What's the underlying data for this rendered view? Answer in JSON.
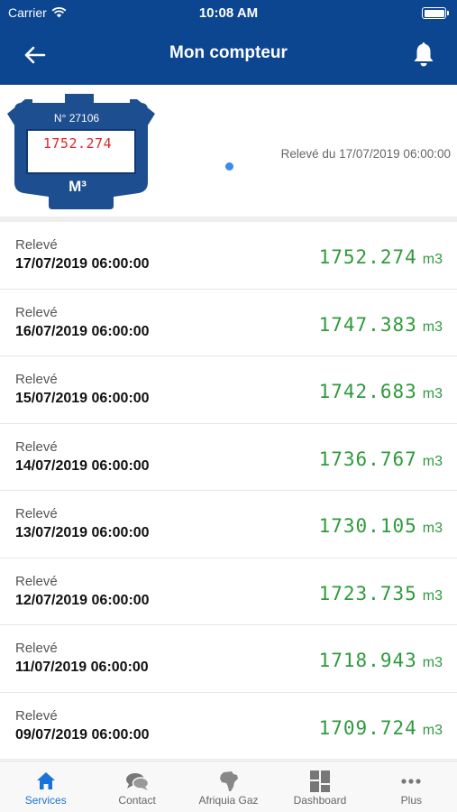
{
  "status_bar": {
    "carrier": "Carrier",
    "time": "10:08 AM"
  },
  "header": {
    "title": "Mon compteur",
    "back_icon": "arrow-left-icon",
    "bell_icon": "bell-icon"
  },
  "meter": {
    "number": "N° 27106",
    "reading": "1752.274",
    "unit": "M³",
    "releve_label": "Relevé du 17/07/2019 06:00:00"
  },
  "readings": [
    {
      "label": "Relevé",
      "date": "17/07/2019 06:00:00",
      "value": "1752.274",
      "unit": "m3"
    },
    {
      "label": "Relevé",
      "date": "16/07/2019 06:00:00",
      "value": "1747.383",
      "unit": "m3"
    },
    {
      "label": "Relevé",
      "date": "15/07/2019 06:00:00",
      "value": "1742.683",
      "unit": "m3"
    },
    {
      "label": "Relevé",
      "date": "14/07/2019 06:00:00",
      "value": "1736.767",
      "unit": "m3"
    },
    {
      "label": "Relevé",
      "date": "13/07/2019 06:00:00",
      "value": "1730.105",
      "unit": "m3"
    },
    {
      "label": "Relevé",
      "date": "12/07/2019 06:00:00",
      "value": "1723.735",
      "unit": "m3"
    },
    {
      "label": "Relevé",
      "date": "11/07/2019 06:00:00",
      "value": "1718.943",
      "unit": "m3"
    },
    {
      "label": "Relevé",
      "date": "09/07/2019 06:00:00",
      "value": "1709.724",
      "unit": "m3"
    }
  ],
  "tabs": [
    {
      "label": "Services",
      "icon": "home-icon",
      "active": true
    },
    {
      "label": "Contact",
      "icon": "chat-bubbles-icon",
      "active": false
    },
    {
      "label": "Afriquia Gaz",
      "icon": "africa-map-icon",
      "active": false
    },
    {
      "label": "Dashboard",
      "icon": "dashboard-grid-icon",
      "active": false
    },
    {
      "label": "Plus",
      "icon": "more-dots-icon",
      "active": false
    }
  ],
  "colors": {
    "header_blue": "#0c4590",
    "reading_green": "#2f9a3c",
    "meter_red": "#e0262d",
    "active_tab": "#1a73d9"
  }
}
